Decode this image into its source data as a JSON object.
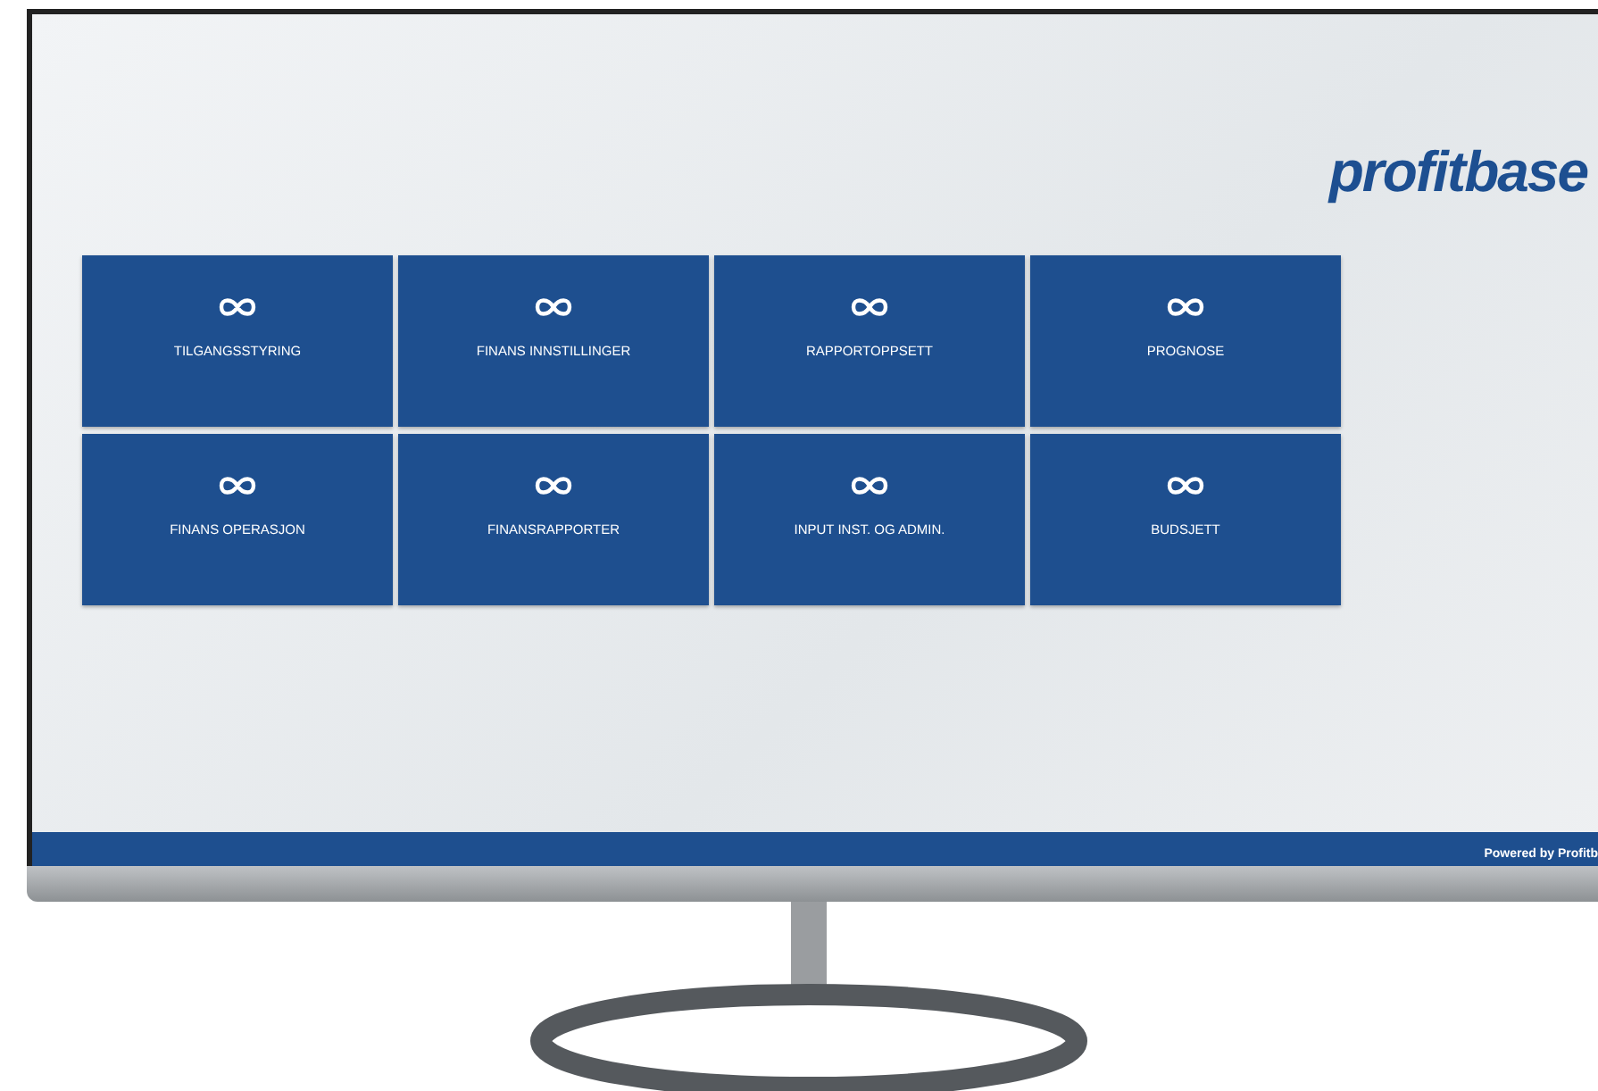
{
  "logo": {
    "text": "profitbase"
  },
  "tiles": [
    {
      "label": "TILGANGSSTYRING"
    },
    {
      "label": "FINANS INNSTILLINGER"
    },
    {
      "label": "RAPPORTOPPSETT"
    },
    {
      "label": "PROGNOSE"
    },
    {
      "label": "FINANS OPERASJON"
    },
    {
      "label": "FINANSRAPPORTER"
    },
    {
      "label": "INPUT INST. OG ADMIN."
    },
    {
      "label": "BUDSJETT"
    }
  ],
  "footer": {
    "text": "Powered by Profitb"
  }
}
